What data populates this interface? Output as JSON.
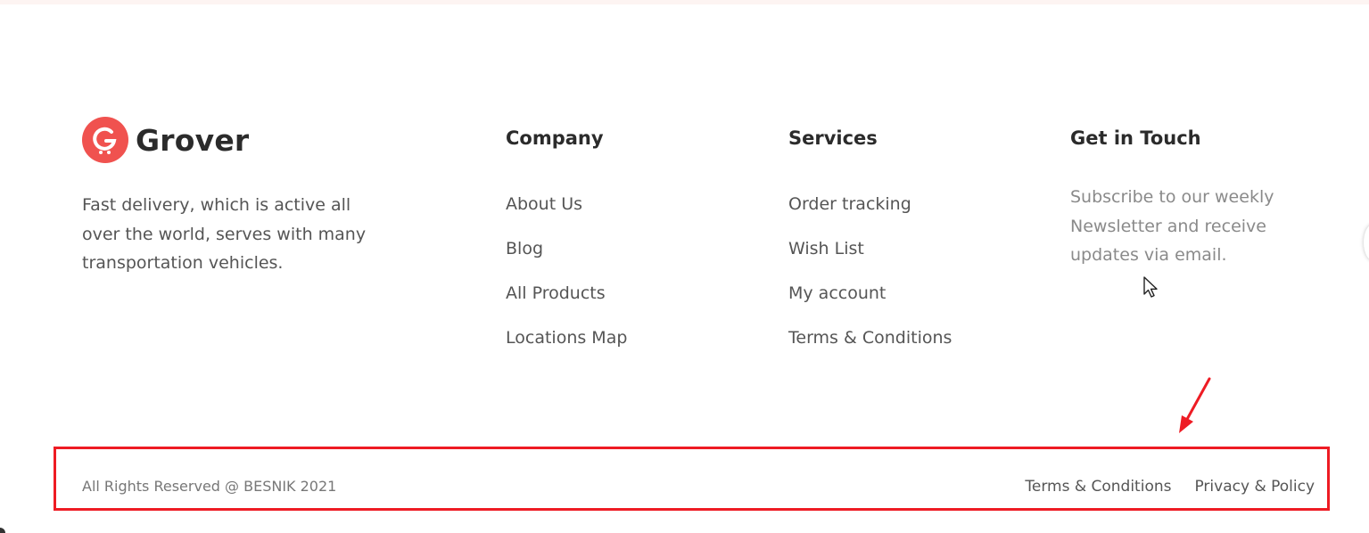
{
  "brand": {
    "name": "Grover",
    "logo_icon": "grover-cart-logo-icon",
    "logo_letter": "G",
    "accent_color": "#f0524f"
  },
  "about": {
    "text": "Fast delivery, which is active all over the world, serves with many transportation vehicles."
  },
  "company": {
    "title": "Company",
    "links": [
      "About Us",
      "Blog",
      "All Products",
      "Locations Map"
    ]
  },
  "services": {
    "title": "Services",
    "links": [
      "Order tracking",
      "Wish List",
      "My account",
      "Terms & Conditions"
    ]
  },
  "touch": {
    "title": "Get in Touch",
    "text": "Subscribe to our weekly Newsletter and receive updates via email."
  },
  "footer": {
    "copyright": "All Rights Reserved @ BESNIK 2021",
    "links": [
      "Terms & Conditions",
      "Privacy & Policy"
    ],
    "highlight_color": "#ee1c24"
  }
}
